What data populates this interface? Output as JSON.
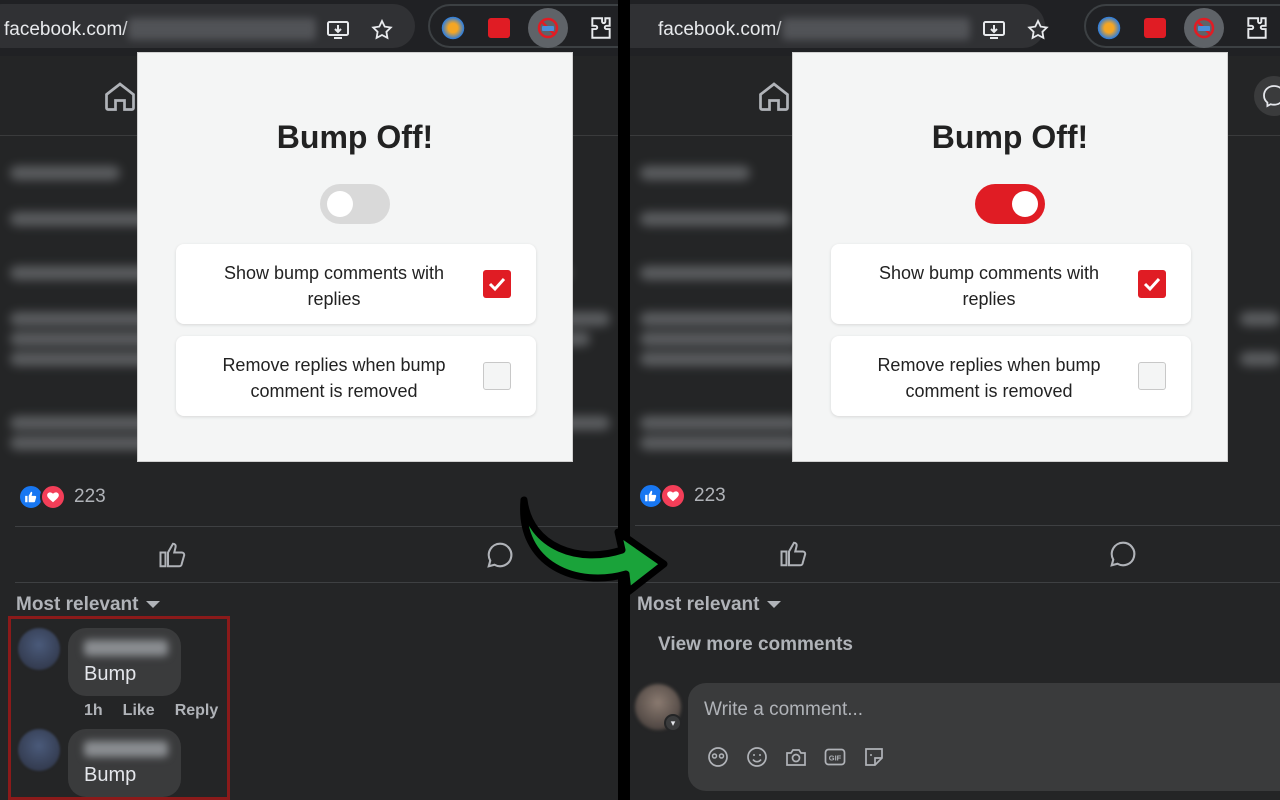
{
  "browser": {
    "url_prefix": "facebook.com/"
  },
  "popup": {
    "title": "Bump Off!",
    "option1_label": "Show bump comments with replies",
    "option2_label": "Remove replies when bump comment is removed"
  },
  "left": {
    "toggle_state": "off",
    "option1_checked": true,
    "option2_checked": false,
    "reaction_count": "223",
    "sort_label": "Most relevant",
    "comments": [
      {
        "text": "Bump",
        "time": "1h",
        "like": "Like",
        "reply": "Reply"
      },
      {
        "text": "Bump"
      }
    ]
  },
  "right": {
    "toggle_state": "on",
    "option1_checked": true,
    "option2_checked": false,
    "reaction_count": "223",
    "sort_label": "Most relevant",
    "view_more": "View more comments",
    "write_placeholder": "Write a comment..."
  },
  "colors": {
    "accent_red": "#e01c24",
    "toggle_off": "#d9d9d9",
    "arrow_green": "#1aa33a",
    "highlight_border": "#8b1a1a",
    "fb_dark": "#242526"
  },
  "icons": [
    "install-icon",
    "star-icon",
    "puzzle-icon",
    "home-icon",
    "messenger-icon",
    "like-icon",
    "comment-icon",
    "avatar-icon",
    "emoji-icon",
    "camera-icon",
    "gif-icon",
    "sticker-icon"
  ]
}
